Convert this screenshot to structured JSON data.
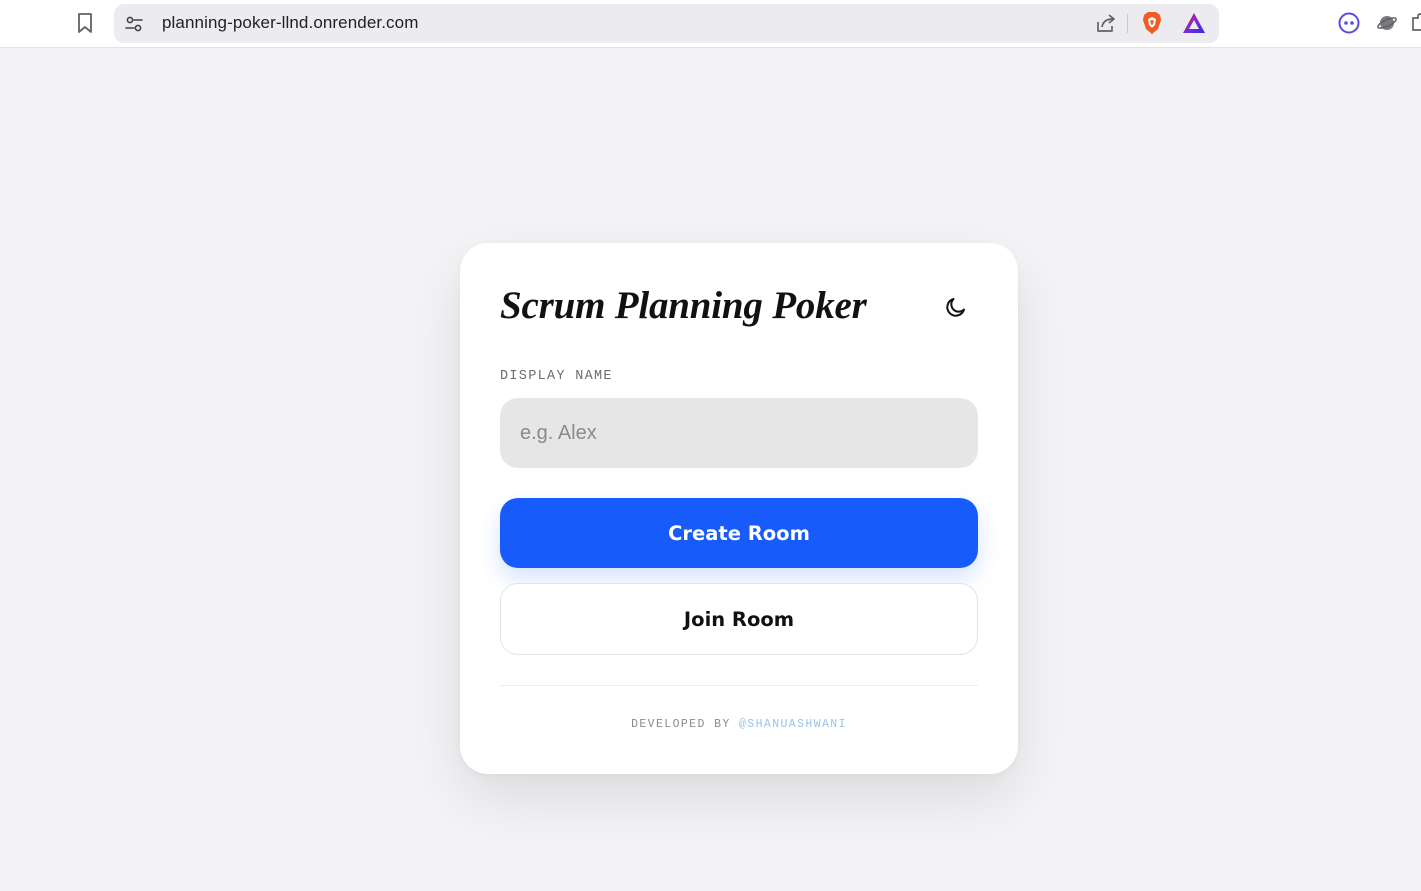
{
  "browser": {
    "url": "planning-poker-llnd.onrender.com"
  },
  "card": {
    "title": "Scrum Planning Poker",
    "display_name_label": "DISPLAY NAME",
    "display_name_value": "",
    "display_name_placeholder": "e.g. Alex",
    "create_label": "Create Room",
    "join_label": "Join Room",
    "footer_prefix": "DEVELOPED BY",
    "footer_author": "@SHANUASHWANI"
  },
  "icons": {
    "bookmark": "bookmark-icon",
    "site_settings": "site-settings-icon",
    "share": "share-icon",
    "brave": "brave-shield-icon",
    "rewards": "brave-rewards-icon",
    "theme": "moon-icon"
  },
  "colors": {
    "accent": "#175cfa",
    "background": "#f4f4f6",
    "input_bg": "#e6e6e6",
    "footer_link": "#9cc2ee"
  }
}
